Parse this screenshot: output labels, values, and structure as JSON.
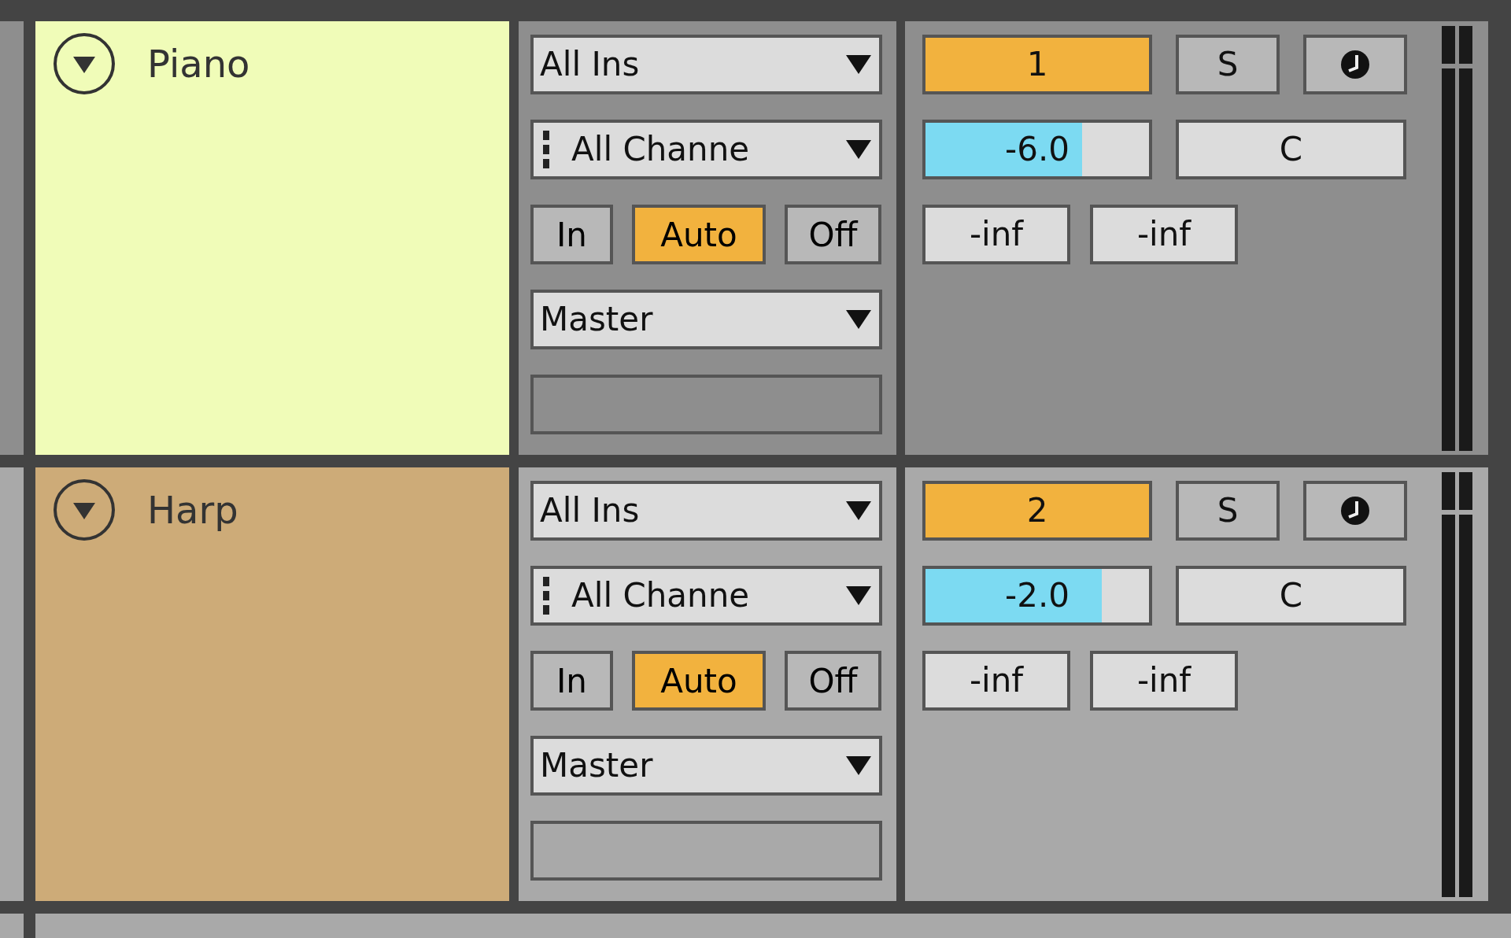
{
  "tracks": [
    {
      "name": "Piano",
      "color": "#f0fcb8",
      "selected": true,
      "expanded": true,
      "input_type": "All Ins",
      "input_channel": "All Channe",
      "monitor": [
        {
          "label": "In",
          "selected": false
        },
        {
          "label": "Auto",
          "selected": true
        },
        {
          "label": "Off",
          "selected": false
        }
      ],
      "output": "Master",
      "number": "1",
      "activated": true,
      "solo": {
        "label": "S",
        "on": false
      },
      "volume": {
        "reading": "-6.0",
        "level": 0.7
      },
      "pan": "C",
      "meters": [
        "-inf",
        "-inf"
      ]
    },
    {
      "name": "Harp",
      "color": "#cdab78",
      "selected": false,
      "expanded": true,
      "input_type": "All Ins",
      "input_channel": "All Channe",
      "monitor": [
        {
          "label": "In",
          "selected": false
        },
        {
          "label": "Auto",
          "selected": true
        },
        {
          "label": "Off",
          "selected": false
        }
      ],
      "output": "Master",
      "number": "2",
      "activated": true,
      "solo": {
        "label": "S",
        "on": false
      },
      "volume": {
        "reading": "-2.0",
        "level": 0.79
      },
      "pan": "C",
      "meters": [
        "-inf",
        "-inf"
      ]
    }
  ]
}
